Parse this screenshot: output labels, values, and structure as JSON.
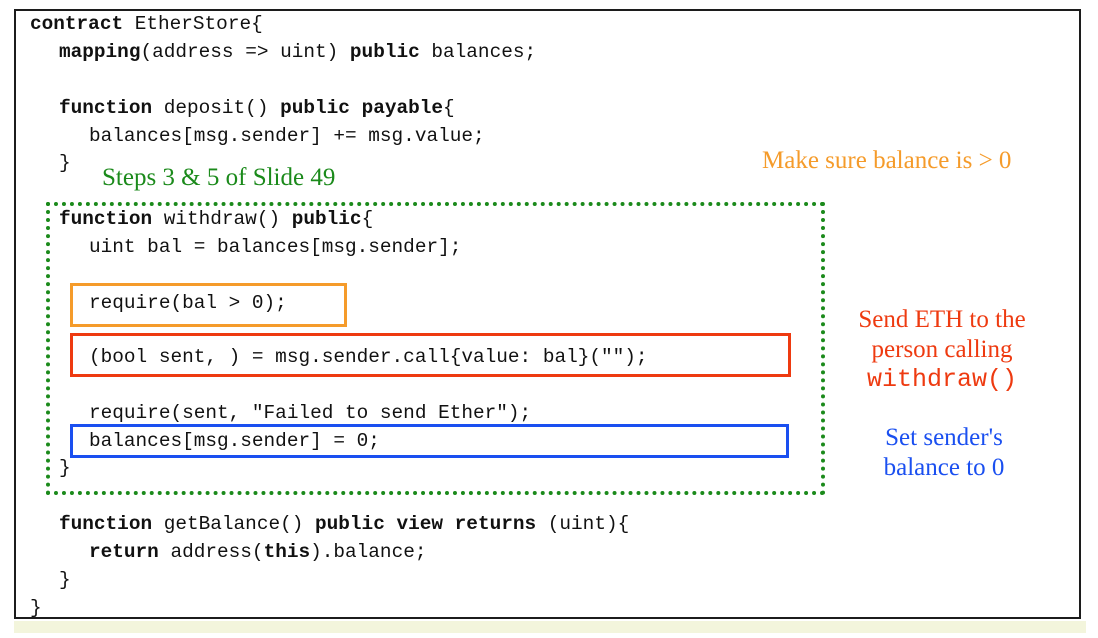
{
  "colors": {
    "orange": "#f59b2a",
    "red": "#ee3a10",
    "blue": "#1a4ff0",
    "green": "#1b8a1b",
    "code_text": "#111111"
  },
  "code": {
    "l1_kw": "contract",
    "l1_rest": " EtherStore{",
    "l2_kw": "mapping",
    "l2_mid": "(address => uint) ",
    "l2_kw2": "public",
    "l2_rest": " balances;",
    "l3_kw": "function",
    "l3_mid": " deposit() ",
    "l3_kw2": "public",
    "l3_sp": " ",
    "l3_kw3": "payable",
    "l3_rest": "{",
    "l4": "balances[msg.sender] += msg.value;",
    "l5": "}",
    "l6_kw": "function",
    "l6_mid": " withdraw() ",
    "l6_kw2": "public",
    "l6_rest": "{",
    "l7": "uint bal = balances[msg.sender];",
    "l8": "require(bal > 0);",
    "l9": "(bool sent, ) = msg.sender.call{value: bal}(\"\");",
    "l10": "require(sent, \"Failed to send Ether\");",
    "l11": "balances[msg.sender] = 0;",
    "l12": "}",
    "l13_kw": "function",
    "l13_mid": " getBalance() ",
    "l13_kw2": "public",
    "l13_sp": " ",
    "l13_kw3": "view",
    "l13_sp2": " ",
    "l13_kw4": "returns",
    "l13_rest": " (uint){",
    "l14_kw": "return",
    "l14_mid": " address(",
    "l14_kw2": "this",
    "l14_rest": ").balance;",
    "l15": "}",
    "l16": "}"
  },
  "annotations": {
    "steps": "Steps 3 & 5 of Slide 49",
    "balance_check": "Make sure balance is > 0",
    "send_line1": "Send ETH to the",
    "send_line2": "person calling",
    "send_line3": "withdraw()",
    "set_line1": "Set sender's",
    "set_line2": "balance to 0"
  }
}
